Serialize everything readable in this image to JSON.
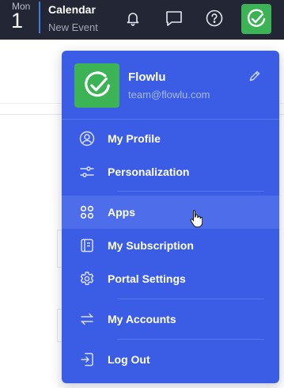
{
  "topbar": {
    "day_name": "Mon",
    "day_number": "1",
    "calendar_title": "Calendar",
    "calendar_subtitle": "New Event",
    "icons": [
      "bell-icon",
      "chat-icon",
      "help-icon",
      "flowlu-logo-icon"
    ]
  },
  "user": {
    "name": "Flowlu",
    "email": "team@flowlu.com"
  },
  "menu": {
    "items": [
      {
        "label": "My Profile",
        "icon": "user-circle-icon"
      },
      {
        "label": "Personalization",
        "icon": "sliders-icon"
      },
      {
        "label": "Apps",
        "icon": "apps-grid-icon"
      },
      {
        "label": "My Subscription",
        "icon": "subscription-icon"
      },
      {
        "label": "Portal Settings",
        "icon": "gear-icon"
      },
      {
        "label": "My Accounts",
        "icon": "switch-arrows-icon"
      },
      {
        "label": "Log Out",
        "icon": "logout-icon"
      }
    ],
    "hovered": "Apps"
  },
  "colors": {
    "topbar": "#232634",
    "menu": "#3b5ce4",
    "menu_hover": "#4d6deb",
    "brand_green": "#3cb456",
    "accent_blue": "#3f7ae0"
  }
}
